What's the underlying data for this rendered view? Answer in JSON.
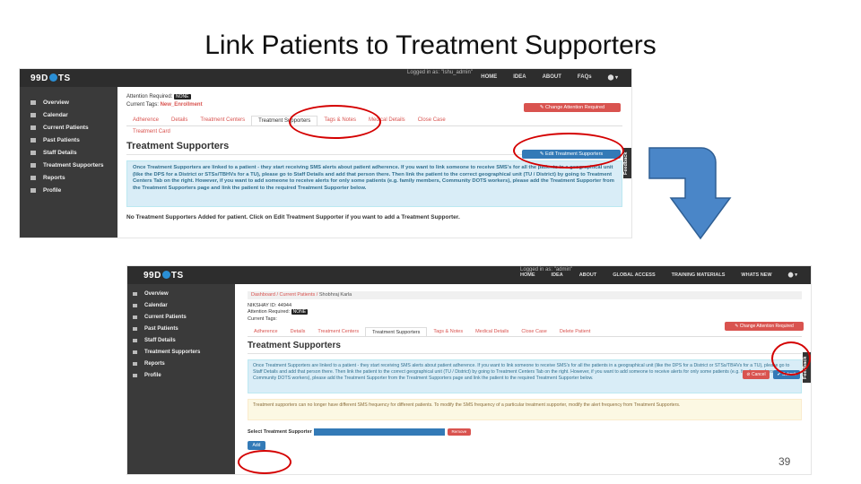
{
  "slide": {
    "title": "Link Patients to Treatment Supporters",
    "page_number": "39"
  },
  "shot1": {
    "logo": "99DOTS",
    "logged_in": "Logged in as: \"Ishu_admin\"",
    "nav": [
      "HOME",
      "IDEA",
      "ABOUT",
      "FAQs",
      "⬤ ▾"
    ],
    "sidebar": [
      "Overview",
      "Calendar",
      "Current Patients",
      "Past Patients",
      "Staff Details",
      "Treatment Supporters",
      "Reports",
      "Profile"
    ],
    "attention_label": "Attention Required:",
    "attention_tag": "NONE",
    "current_tags_label": "Current Tags:",
    "current_tags_value": "New_Enrollment",
    "change_attention_btn": "✎ Change Attention Required",
    "tabs": [
      "Adherence",
      "Details",
      "Treatment Centers",
      "Treatment Supporters",
      "Tags & Notes",
      "Medical Details",
      "Close Case"
    ],
    "second_row_tab": "Treatment Card",
    "heading": "Treatment Supporters",
    "edit_btn": "✎ Edit Treatment Supporters",
    "info": "Once Treatment Supporters are linked to a patient - they start receiving SMS alerts about patient adherence. If you want to link someone to receive SMS's for all the patients in a geographical unit (like the DPS for a District or STSs/TBHVs for a TU), please go to Staff Details and add that person there. Then link the patient to the correct geographical unit (TU / District) by going to Treatment Centers Tab on the right. However, if you want to add someone to receive alerts for only some patients (e.g. family members, Community DOTS workers), please add the Treatment Supporter from the Treatment Supporters page and link the patient to the required Treatment Supporter below.",
    "no_supporters": "No Treatment Supporters Added for patient. Click on Edit Treatment Supporter if you want to add a Treatment Supporter.",
    "feedback": "Feedback"
  },
  "shot2": {
    "logo": "99DOTS",
    "logged_in": "Logged in as: \"admin\"",
    "nav": [
      "HOME",
      "IDEA",
      "ABOUT",
      "GLOBAL ACCESS",
      "TRAINING MATERIALS",
      "WHATS NEW",
      "⬤ ▾"
    ],
    "sidebar": [
      "Overview",
      "Calendar",
      "Current Patients",
      "Past Patients",
      "Staff Details",
      "Treatment Supporters",
      "Reports",
      "Profile"
    ],
    "breadcrumb": [
      "Dashboard",
      "Current Patients",
      "Shobhraj Karla"
    ],
    "nikshay_id": "NIKSHAY ID: 44944",
    "attention_label": "Attention Required:",
    "attention_tag": "NONE",
    "current_tags_label": "Current Tags:",
    "change_attention_btn": "✎ Change Attention Required",
    "tabs": [
      "Adherence",
      "Details",
      "Treatment Centers",
      "Treatment Supporters",
      "Tags & Notes",
      "Medical Details",
      "Close Case",
      "Delete Patient"
    ],
    "heading": "Treatment Supporters",
    "cancel_btn": "⊘ Cancel",
    "submit_btn": "✔ Submit",
    "info": "Once Treatment Supporters are linked to a patient - they start receiving SMS alerts about patient adherence. If you want to link someone to receive SMS's for all the patients in a geographical unit (like the DPS for a District or STSs/TBHVs for a TU), please go to Staff Details and add that person there. Then link the patient to the correct geographical unit (TU / District) by going to Treatment Centers Tab on the right. However, if you want to add someone to receive alerts for only some patients (e.g. family members, Community DOTS workers), please add the Treatment Supporter from the Treatment Supporters page and link the patient to the required Treatment Supporter below.",
    "warning": "Treatment supporters can no longer have different SMS frequency for different patients. To modify the SMS frequency of a particular treatment supporter, modify the alert frequency from Treatment Supporters.",
    "select_label": "Select Treatment Supporter",
    "remove_btn": "Remove",
    "add_btn": "Add",
    "feedback": "Feedback"
  },
  "colors": {
    "accent_red": "#d9534f",
    "accent_blue": "#337ab7",
    "annotation_red": "#d40000",
    "arrow_blue": "#4a86c8"
  }
}
